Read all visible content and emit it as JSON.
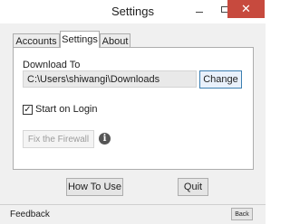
{
  "window": {
    "title": "Settings"
  },
  "tabs": [
    {
      "label": "Accounts",
      "selected": false
    },
    {
      "label": "Settings",
      "selected": true
    },
    {
      "label": "About",
      "selected": false
    }
  ],
  "download": {
    "label": "Download To",
    "path": "C:\\Users\\shiwangi\\Downloads",
    "change_label": "Change"
  },
  "startup": {
    "label": "Start on Login",
    "checked": true,
    "check_glyph": "✓"
  },
  "firewall": {
    "label": "Fix the Firewall",
    "enabled": false,
    "info_glyph": "i"
  },
  "actions": {
    "how_to_use": "How To Use",
    "quit": "Quit"
  },
  "footer": {
    "feedback": "Feedback",
    "back": "Back"
  },
  "controls": {
    "close_glyph": "✕"
  },
  "colors": {
    "close_button": "#c74a3e",
    "change_border": "#3c7fb1"
  }
}
